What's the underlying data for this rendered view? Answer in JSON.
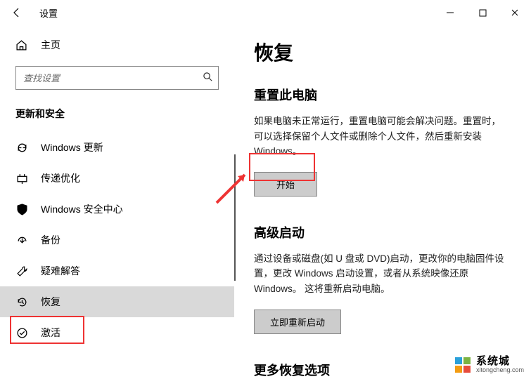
{
  "titlebar": {
    "title": "设置"
  },
  "sidebar": {
    "home": "主页",
    "search_placeholder": "查找设置",
    "section": "更新和安全",
    "items": [
      {
        "label": "Windows 更新"
      },
      {
        "label": "传递优化"
      },
      {
        "label": "Windows 安全中心"
      },
      {
        "label": "备份"
      },
      {
        "label": "疑难解答"
      },
      {
        "label": "恢复"
      },
      {
        "label": "激活"
      }
    ]
  },
  "main": {
    "title": "恢复",
    "reset": {
      "heading": "重置此电脑",
      "body": "如果电脑未正常运行，重置电脑可能会解决问题。重置时，可以选择保留个人文件或删除个人文件，然后重新安装 Windows。",
      "button": "开始"
    },
    "advanced": {
      "heading": "高级启动",
      "body": "通过设备或磁盘(如 U 盘或 DVD)启动，更改你的电脑固件设置，更改 Windows 启动设置，或者从系统映像还原 Windows。 这将重新启动电脑。",
      "button": "立即重新启动"
    },
    "more": {
      "heading": "更多恢复选项"
    }
  },
  "watermark": {
    "name": "系统城",
    "url": "xitongcheng.com"
  }
}
